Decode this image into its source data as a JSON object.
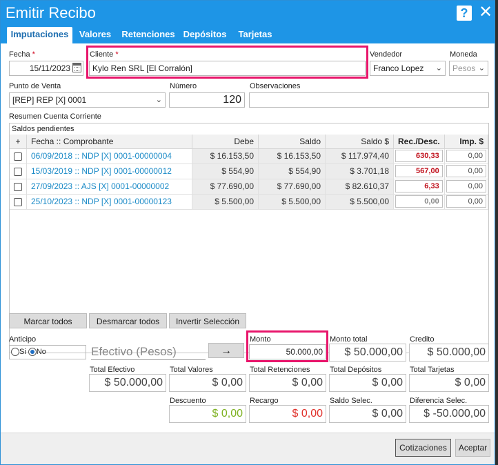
{
  "window": {
    "title": "Emitir Recibo",
    "help_glyph": "?",
    "close_glyph": "✕"
  },
  "tabs": [
    {
      "label": "Imputaciones",
      "active": true
    },
    {
      "label": "Valores"
    },
    {
      "label": "Retenciones"
    },
    {
      "label": "Depósitos"
    },
    {
      "label": "Tarjetas"
    }
  ],
  "header": {
    "fecha_label": "Fecha",
    "fecha_value": "15/11/2023",
    "cliente_label": "Cliente",
    "cliente_value": "Kylo Ren SRL [El Corralón]",
    "vendedor_label": "Vendedor",
    "vendedor_value": "Franco Lopez",
    "moneda_label": "Moneda",
    "moneda_value": "Pesos",
    "required_mark": "*"
  },
  "row2": {
    "punto_label": "Punto de Venta",
    "punto_value": "[REP] REP [X] 0001",
    "numero_label": "Número",
    "numero_value": "120",
    "obs_label": "Observaciones",
    "obs_value": ""
  },
  "resumen": {
    "section_label": "Resumen Cuenta Corriente",
    "grid_title": "Saldos pendientes",
    "columns": [
      "+",
      "Fecha :: Comprobante",
      "Debe",
      "Saldo",
      "Saldo $",
      "Rec./Desc.",
      "Imp. $"
    ],
    "rows": [
      {
        "comprobante": "06/09/2018 :: NDP [X] 0001-00000004",
        "debe": "$ 16.153,50",
        "saldo": "$ 16.153,50",
        "saldo_pesos": "$ 117.974,40",
        "rec": "630,33",
        "imp": "0,00"
      },
      {
        "comprobante": "15/03/2019 :: NDP [X] 0001-00000012",
        "debe": "$ 554,90",
        "saldo": "$ 554,90",
        "saldo_pesos": "$ 3.701,18",
        "rec": "567,00",
        "imp": "0,00"
      },
      {
        "comprobante": "27/09/2023 :: AJS [X] 0001-00000002",
        "debe": "$ 77.690,00",
        "saldo": "$ 77.690,00",
        "saldo_pesos": "$ 82.610,37",
        "rec": "6,33",
        "imp": "0,00"
      },
      {
        "comprobante": "25/10/2023 :: NDP [X] 0001-00000123",
        "debe": "$ 5.500,00",
        "saldo": "$ 5.500,00",
        "saldo_pesos": "$ 5.500,00",
        "rec": "0,00",
        "imp": "0,00"
      }
    ]
  },
  "actions": {
    "marcar": "Marcar todos",
    "desmarcar": "Desmarcar todos",
    "invertir": "Invertir Selección"
  },
  "anticipo": {
    "label": "Anticipo",
    "si": "Si",
    "no": "No",
    "selected": "No",
    "efectivo_label": "Efectivo (Pesos)",
    "arrow": "→"
  },
  "totals": {
    "monto_label": "Monto",
    "monto_value": "50.000,00",
    "monto_total_label": "Monto total",
    "monto_total_value": "$ 50.000,00",
    "credito_label": "Credito",
    "credito_value": "$ 50.000,00",
    "total_efectivo_label": "Total Efectivo",
    "total_efectivo_value": "$ 50.000,00",
    "total_valores_label": "Total Valores",
    "total_valores_value": "$ 0,00",
    "total_retenciones_label": "Total Retenciones",
    "total_retenciones_value": "$ 0,00",
    "total_depositos_label": "Total Depósitos",
    "total_depositos_value": "$ 0,00",
    "total_tarjetas_label": "Total Tarjetas",
    "total_tarjetas_value": "$ 0,00",
    "descuento_label": "Descuento",
    "descuento_value": "$ 0,00",
    "recargo_label": "Recargo",
    "recargo_value": "$ 0,00",
    "saldo_selec_label": "Saldo Selec.",
    "saldo_selec_value": "$ 0,00",
    "diferencia_label": "Diferencia Selec.",
    "diferencia_value": "$ -50.000,00"
  },
  "footer": {
    "cotizaciones": "Cotizaciones",
    "aceptar": "Aceptar"
  },
  "colors": {
    "titlebar": "#1e95e6",
    "highlight": "#e8156b",
    "link": "#1a8ac7",
    "rec_red": "#c0101b"
  }
}
